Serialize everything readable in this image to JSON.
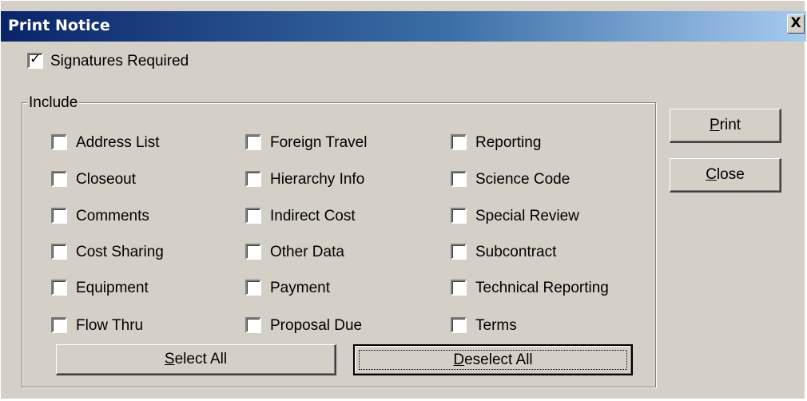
{
  "window": {
    "title": "Print Notice",
    "close_glyph": "X"
  },
  "signatures": {
    "label": "Signatures Required",
    "checked": true
  },
  "include": {
    "group_label": "Include",
    "columns": [
      [
        "Address List",
        "Closeout",
        "Comments",
        "Cost Sharing",
        "Equipment",
        "Flow Thru"
      ],
      [
        "Foreign Travel",
        "Hierarchy Info",
        "Indirect Cost",
        "Other Data",
        "Payment",
        "Proposal Due"
      ],
      [
        "Reporting",
        "Science Code",
        "Special Review",
        "Subcontract",
        "Technical Reporting",
        "Terms"
      ]
    ]
  },
  "buttons": {
    "print": {
      "mnemonic": "P",
      "rest": "rint"
    },
    "close": {
      "mnemonic": "C",
      "rest": "lose"
    },
    "select_all": {
      "mnemonic": "S",
      "rest": "elect All"
    },
    "deselect_all": {
      "mnemonic": "D",
      "rest": "eselect All"
    }
  },
  "colors": {
    "titlebar_start": "#0a246a",
    "titlebar_end": "#a6caf0",
    "dialog_face": "#d4d0c8"
  },
  "icons": {
    "close": "close-icon",
    "check": "check-icon"
  }
}
